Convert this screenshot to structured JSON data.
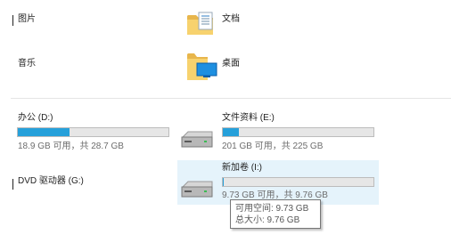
{
  "folders": [
    {
      "name": "图片",
      "icon": "pictures-folder-icon"
    },
    {
      "name": "文档",
      "icon": "documents-folder-icon"
    },
    {
      "name": "音乐",
      "icon": "music-folder-icon"
    },
    {
      "name": "桌面",
      "icon": "desktop-folder-icon"
    }
  ],
  "drives": [
    {
      "label": "办公 (D:)",
      "free_text": "18.9 GB 可用，共 28.7 GB",
      "used_fraction": 0.341,
      "bar_color": "#26a0da"
    },
    {
      "label": "文件资料 (E:)",
      "free_text": "201 GB 可用，共 225 GB",
      "used_fraction": 0.107,
      "bar_color": "#26a0da",
      "icon": "hard-drive-icon"
    },
    {
      "label": "DVD 驱动器 (G:)"
    },
    {
      "label": "新加卷 (I:)",
      "free_text": "9.73 GB 可用，共 9.76 GB",
      "used_fraction": 0.003,
      "bar_color": "#26a0da",
      "icon": "hard-drive-icon"
    }
  ],
  "tooltip": {
    "line1": "可用空间: 9.73 GB",
    "line2": "总大小: 9.76 GB"
  },
  "colors": {
    "accent": "#26a0da",
    "hover": "#e5f3fb"
  }
}
